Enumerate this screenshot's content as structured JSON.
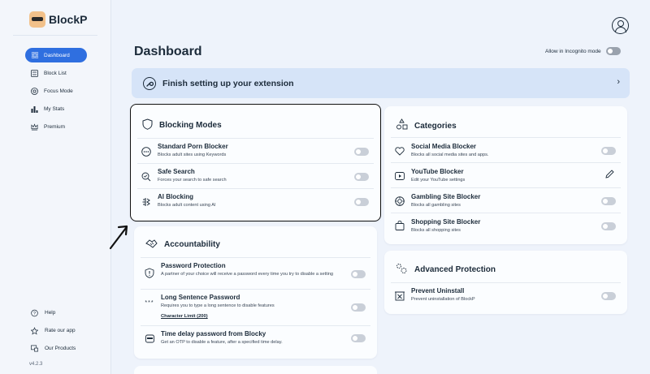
{
  "app": {
    "name": "BlockP",
    "version": "v4.2.3"
  },
  "sidebar": {
    "items": [
      {
        "label": "Dashboard",
        "icon": "grid-icon",
        "active": true
      },
      {
        "label": "Block List",
        "icon": "list-icon",
        "active": false
      },
      {
        "label": "Focus Mode",
        "icon": "target-icon",
        "active": false
      },
      {
        "label": "My Stats",
        "icon": "bar-chart-icon",
        "active": false
      },
      {
        "label": "Premium",
        "icon": "crown-icon",
        "active": false
      }
    ],
    "bottom": [
      {
        "label": "Help",
        "icon": "help-icon"
      },
      {
        "label": "Rate our app",
        "icon": "star-icon"
      },
      {
        "label": "Our Products",
        "icon": "products-icon"
      }
    ]
  },
  "header": {
    "title": "Dashboard",
    "incognito_label": "Allow in Incognito mode"
  },
  "banner": {
    "label": "Finish setting up your extension"
  },
  "blocking_modes": {
    "title": "Blocking Modes",
    "items": [
      {
        "title": "Standard Porn Blocker",
        "desc": "Blocks adult sites using Keywords"
      },
      {
        "title": "Safe Search",
        "desc": "Forces your search to safe search"
      },
      {
        "title": "AI Blocking",
        "desc": "Blocks adult content using AI"
      }
    ]
  },
  "accountability": {
    "title": "Accountability",
    "items": [
      {
        "title": "Password Protection",
        "desc": "A partner of your choice will receive a password every time you try to disable a setting"
      },
      {
        "title": "Long Sentence Password",
        "desc": "Requires you to type a long sentence to disable features",
        "link": "Character Limit (200)"
      },
      {
        "title": "Time delay password from Blocky",
        "desc": "Get an OTP to disable a feature, after a specified time delay."
      }
    ]
  },
  "categories": {
    "title": "Categories",
    "items": [
      {
        "title": "Social Media Blocker",
        "desc": "Blocks all social media sites and apps."
      },
      {
        "title": "YouTube Blocker",
        "desc": "Edit your YouTube settings"
      },
      {
        "title": "Gambling Site Blocker",
        "desc": "Blocks all gambling sites"
      },
      {
        "title": "Shopping Site Blocker",
        "desc": "Blocks all shopping sites"
      }
    ]
  },
  "advanced": {
    "title": "Advanced Protection",
    "items": [
      {
        "title": "Prevent Uninstall",
        "desc": "Prevent uninstallation of BlockP"
      }
    ]
  },
  "colors": {
    "accent": "#2f6fe0",
    "banner": "#d6e4f8",
    "toggle_off": "#c9cfd8"
  }
}
